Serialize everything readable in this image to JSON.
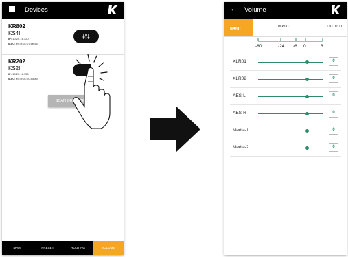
{
  "left_screen": {
    "title": "Devices",
    "devices": [
      {
        "name": "KR802",
        "model": "KS4I",
        "ip_label": "IP:",
        "ip": "10.20.16.120",
        "mac_label": "MAC:",
        "mac": "e4:5f:01:07:de:56"
      },
      {
        "name": "KR202",
        "model": "KS2I",
        "ip_label": "IP:",
        "ip": "10.20.16.136",
        "mac_label": "MAC:",
        "mac": "e4:5f:01:20:d5:a5"
      }
    ],
    "scan_button": "SCAN QR CODE",
    "nav": {
      "items": [
        "MAIN",
        "PRESET",
        "ROUTING",
        "VOLUME"
      ],
      "active": "VOLUME"
    }
  },
  "right_screen": {
    "title": "Volume",
    "back_icon": "←",
    "tabs": {
      "input_gain_line1": "INPUT",
      "input_gain_line2": "GAIN",
      "input": "INPUT",
      "output": "OUTPUT",
      "active": "INPUT GAIN"
    },
    "scale_ticks": [
      "-80",
      "-24",
      "-6",
      "0",
      "6"
    ],
    "channels": [
      {
        "name": "XLR01",
        "value": "0",
        "level": 0
      },
      {
        "name": "XLR02",
        "value": "0",
        "level": 0
      },
      {
        "name": "AES-L",
        "value": "0",
        "level": 0
      },
      {
        "name": "AES-R",
        "value": "0",
        "level": 0
      },
      {
        "name": "Media-1",
        "value": "0",
        "level": 0
      },
      {
        "name": "Media-2",
        "value": "0",
        "level": 0
      }
    ]
  },
  "colors": {
    "accent": "#f5a623",
    "slider": "#2e8b6e",
    "bar": "#000000"
  },
  "icons": [
    "menu-icon",
    "kramer-logo-icon",
    "equalizer-icon",
    "back-arrow-icon",
    "tapping-hand-icon",
    "right-arrow-icon"
  ]
}
